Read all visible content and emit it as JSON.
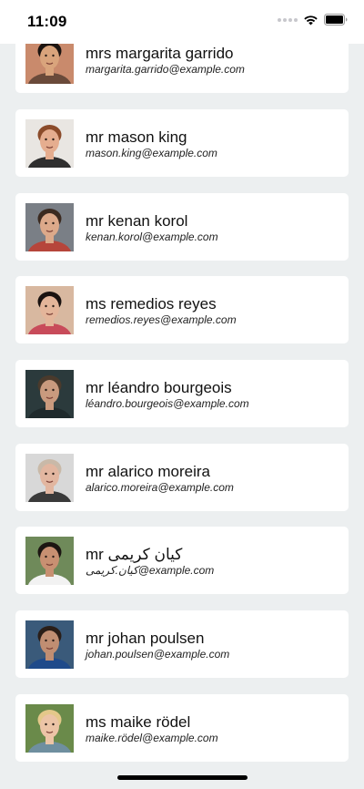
{
  "status_bar": {
    "time": "11:09",
    "icons": [
      "cellular-signal-icon",
      "wifi-icon",
      "battery-icon"
    ]
  },
  "contacts": [
    {
      "name": "mrs margarita garrido",
      "email": "margarita.garrido@example.com",
      "avatar": "photo-avatar",
      "avatar_colors": {
        "bg": "#c98a6c",
        "skin": "#d9a47c",
        "hair": "#1c1410",
        "shirt": "#6a4a3a"
      }
    },
    {
      "name": "mr mason king",
      "email": "mason.king@example.com",
      "avatar": "photo-avatar",
      "avatar_colors": {
        "bg": "#e9e6e2",
        "skin": "#e5ad8f",
        "hair": "#8b4b2a",
        "shirt": "#2f2f2f"
      }
    },
    {
      "name": "mr kenan korol",
      "email": "kenan.korol@example.com",
      "avatar": "photo-avatar",
      "avatar_colors": {
        "bg": "#7a7f86",
        "skin": "#dca98a",
        "hair": "#3b2a20",
        "shirt": "#b6453b"
      }
    },
    {
      "name": "ms remedios reyes",
      "email": "remedios.reyes@example.com",
      "avatar": "photo-avatar",
      "avatar_colors": {
        "bg": "#d8b8a0",
        "skin": "#e4b59a",
        "hair": "#1a1210",
        "shirt": "#c84b5a"
      }
    },
    {
      "name": "mr léandro bourgeois",
      "email": "léandro.bourgeois@example.com",
      "avatar": "photo-avatar",
      "avatar_colors": {
        "bg": "#2b3a3c",
        "skin": "#c99a7e",
        "hair": "#4a3a2c",
        "shirt": "#1f2a2c"
      }
    },
    {
      "name": "mr alarico moreira",
      "email": "alarico.moreira@example.com",
      "avatar": "photo-avatar",
      "avatar_colors": {
        "bg": "#d8d8d8",
        "skin": "#e2b6a0",
        "hair": "#c9b9a8",
        "shirt": "#3a3a3a"
      }
    },
    {
      "name": "mr کیان کریمی",
      "email": "کیان.کریمی@example.com",
      "avatar": "photo-avatar",
      "avatar_colors": {
        "bg": "#6f8a5a",
        "skin": "#c89072",
        "hair": "#1c1612",
        "shirt": "#f2f2f2"
      }
    },
    {
      "name": "mr johan poulsen",
      "email": "johan.poulsen@example.com",
      "avatar": "photo-avatar",
      "avatar_colors": {
        "bg": "#3a5a7a",
        "skin": "#c08e72",
        "hair": "#2a1e18",
        "shirt": "#1f4a8a"
      }
    },
    {
      "name": "ms maike rödel",
      "email": "maike.rödel@example.com",
      "avatar": "photo-avatar",
      "avatar_colors": {
        "bg": "#6a8a4a",
        "skin": "#ecc4a6",
        "hair": "#e4c88a",
        "shirt": "#6f8f9f"
      }
    }
  ]
}
